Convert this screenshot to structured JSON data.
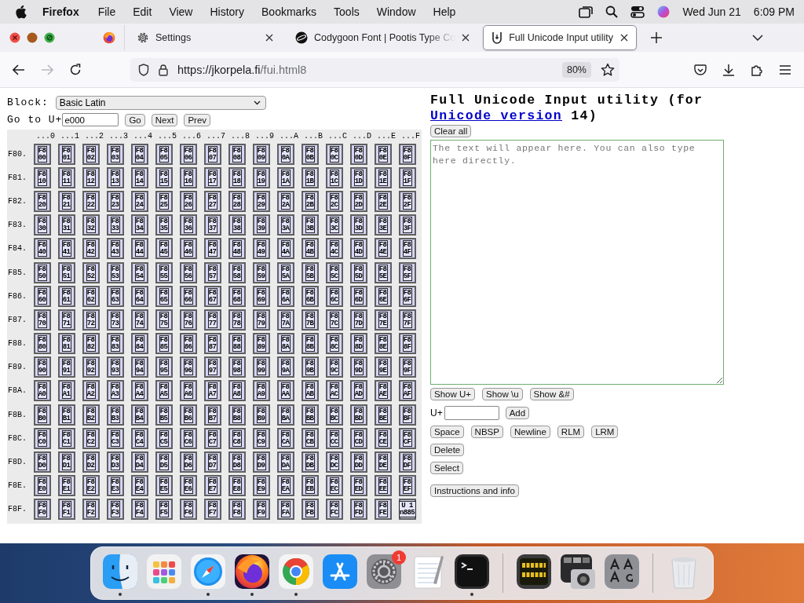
{
  "menubar": {
    "app": "Firefox",
    "menus": [
      "File",
      "Edit",
      "View",
      "History",
      "Bookmarks",
      "Tools",
      "Window",
      "Help"
    ],
    "date": "Wed Jun 21",
    "time": "6:09 PM"
  },
  "tabs": [
    {
      "kind": "pinned",
      "selected": false
    },
    {
      "kind": "settings",
      "label": "Settings",
      "selected": false
    },
    {
      "kind": "site",
      "label": "Codygoon Font | Pootis Type Co",
      "selected": false
    },
    {
      "kind": "unicode",
      "label": "Full Unicode Input utility",
      "selected": true
    }
  ],
  "address": {
    "host": "https://jkorpela.fi",
    "path": "/fui.html8",
    "zoom": "80%"
  },
  "left": {
    "block_label": "Block:",
    "block_value": "Basic Latin",
    "goto_label": "Go to U+",
    "goto_value": "e000",
    "buttons": [
      "Go",
      "Next",
      "Prev"
    ],
    "columns": [
      "...0",
      "...1",
      "...2",
      "...3",
      "...4",
      "...5",
      "...6",
      "...7",
      "...8",
      "...9",
      "...A",
      "...B",
      "...C",
      "...D",
      "...E",
      "...F"
    ],
    "rows": [
      {
        "label": "F80.",
        "cells": [
          "F8\n00",
          "F8\n01",
          "F8\n02",
          "F8\n03",
          "F8\n04",
          "F8\n05",
          "F8\n06",
          "F8\n07",
          "F8\n08",
          "F8\n09",
          "F8\n0A",
          "F8\n0B",
          "F8\n0C",
          "F8\n0D",
          "F8\n0E",
          "F8\n0F"
        ]
      },
      {
        "label": "F81.",
        "cells": [
          "F8\n10",
          "F8\n11",
          "F8\n12",
          "F8\n13",
          "F8\n14",
          "F8\n15",
          "F8\n16",
          "F8\n17",
          "F8\n18",
          "F8\n19",
          "F8\n1A",
          "F8\n1B",
          "F8\n1C",
          "F8\n1D",
          "F8\n1E",
          "F8\n1F"
        ]
      },
      {
        "label": "F82.",
        "cells": [
          "F8\n20",
          "F8\n21",
          "F8\n22",
          "F8\n23",
          "F8\n24",
          "F8\n25",
          "F8\n26",
          "F8\n27",
          "F8\n28",
          "F8\n29",
          "F8\n2A",
          "F8\n2B",
          "F8\n2C",
          "F8\n2D",
          "F8\n2E",
          "F8\n2F"
        ]
      },
      {
        "label": "F83.",
        "cells": [
          "F8\n30",
          "F8\n31",
          "F8\n32",
          "F8\n33",
          "F8\n34",
          "F8\n35",
          "F8\n36",
          "F8\n37",
          "F8\n38",
          "F8\n39",
          "F8\n3A",
          "F8\n3B",
          "F8\n3C",
          "F8\n3D",
          "F8\n3E",
          "F8\n3F"
        ]
      },
      {
        "label": "F84.",
        "cells": [
          "F8\n40",
          "F8\n41",
          "F8\n42",
          "F8\n43",
          "F8\n44",
          "F8\n45",
          "F8\n46",
          "F8\n47",
          "F8\n48",
          "F8\n49",
          "F8\n4A",
          "F8\n4B",
          "F8\n4C",
          "F8\n4D",
          "F8\n4E",
          "F8\n4F"
        ]
      },
      {
        "label": "F85.",
        "cells": [
          "F8\n50",
          "F8\n51",
          "F8\n52",
          "F8\n53",
          "F8\n54",
          "F8\n55",
          "F8\n56",
          "F8\n57",
          "F8\n58",
          "F8\n59",
          "F8\n5A",
          "F8\n5B",
          "F8\n5C",
          "F8\n5D",
          "F8\n5E",
          "F8\n5F"
        ]
      },
      {
        "label": "F86.",
        "cells": [
          "F8\n60",
          "F8\n61",
          "F8\n62",
          "F8\n63",
          "F8\n64",
          "F8\n65",
          "F8\n66",
          "F8\n67",
          "F8\n68",
          "F8\n69",
          "F8\n6A",
          "F8\n6B",
          "F8\n6C",
          "F8\n6D",
          "F8\n6E",
          "F8\n6F"
        ]
      },
      {
        "label": "F87.",
        "cells": [
          "F8\n70",
          "F8\n71",
          "F8\n72",
          "F8\n73",
          "F8\n74",
          "F8\n75",
          "F8\n76",
          "F8\n77",
          "F8\n78",
          "F8\n79",
          "F8\n7A",
          "F8\n7B",
          "F8\n7C",
          "F8\n7D",
          "F8\n7E",
          "F8\n7F"
        ]
      },
      {
        "label": "F88.",
        "cells": [
          "F8\n80",
          "F8\n81",
          "F8\n82",
          "F8\n83",
          "F8\n84",
          "F8\n85",
          "F8\n86",
          "F8\n87",
          "F8\n88",
          "F8\n89",
          "F8\n8A",
          "F8\n8B",
          "F8\n8C",
          "F8\n8D",
          "F8\n8E",
          "F8\n8F"
        ]
      },
      {
        "label": "F89.",
        "cells": [
          "F8\n90",
          "F8\n91",
          "F8\n92",
          "F8\n93",
          "F8\n94",
          "F8\n95",
          "F8\n96",
          "F8\n97",
          "F8\n98",
          "F8\n99",
          "F8\n9A",
          "F8\n9B",
          "F8\n9C",
          "F8\n9D",
          "F8\n9E",
          "F8\n9F"
        ]
      },
      {
        "label": "F8A.",
        "cells": [
          "F8\nA0",
          "F8\nA1",
          "F8\nA2",
          "F8\nA3",
          "F8\nA4",
          "F8\nA5",
          "F8\nA6",
          "F8\nA7",
          "F8\nA8",
          "F8\nA9",
          "F8\nAA",
          "F8\nAB",
          "F8\nAC",
          "F8\nAD",
          "F8\nAE",
          "F8\nAF"
        ]
      },
      {
        "label": "F8B.",
        "cells": [
          "F8\nB0",
          "F8\nB1",
          "F8\nB2",
          "F8\nB3",
          "F8\nB4",
          "F8\nB5",
          "F8\nB6",
          "F8\nB7",
          "F8\nB8",
          "F8\nB9",
          "F8\nBA",
          "F8\nBB",
          "F8\nBC",
          "F8\nBD",
          "F8\nBE",
          "F8\nBF"
        ]
      },
      {
        "label": "F8C.",
        "cells": [
          "F8\nC0",
          "F8\nC1",
          "F8\nC2",
          "F8\nC3",
          "F8\nC4",
          "F8\nC5",
          "F8\nC6",
          "F8\nC7",
          "F8\nC8",
          "F8\nC9",
          "F8\nCA",
          "F8\nCB",
          "F8\nCC",
          "F8\nCD",
          "F8\nCE",
          "F8\nCF"
        ]
      },
      {
        "label": "F8D.",
        "cells": [
          "F8\nD0",
          "F8\nD1",
          "F8\nD2",
          "F8\nD3",
          "F8\nD4",
          "F8\nD5",
          "F8\nD6",
          "F8\nD7",
          "F8\nD8",
          "F8\nD9",
          "F8\nDA",
          "F8\nDB",
          "F8\nDC",
          "F8\nDD",
          "F8\nDE",
          "F8\nDF"
        ]
      },
      {
        "label": "F8E.",
        "cells": [
          "F8\nE0",
          "F8\nE1",
          "F8\nE2",
          "F8\nE3",
          "F8\nE4",
          "F8\nE5",
          "F8\nE6",
          "F8\nE7",
          "F8\nE8",
          "F8\nE9",
          "F8\nEA",
          "F8\nEB",
          "F8\nEC",
          "F8\nED",
          "F8\nEE",
          "F8\nEF"
        ]
      },
      {
        "label": "F8F.",
        "cells": [
          "F8\nF0",
          "F8\nF1",
          "F8\nF2",
          "F8\nF3",
          "F8\nF4",
          "F8\nF5",
          "F8\nF6",
          "F8\nF7",
          "F8\nF8",
          "F8\nF9",
          "F8\nFA",
          "F8\nFB",
          "F8\nFC",
          "F8\nFD",
          "F8\nFE",
          "U 1\nn885"
        ]
      }
    ]
  },
  "right": {
    "title_before": "Full Unicode Input utility (for ",
    "title_link": "Unicode version",
    "title_after": " 14)",
    "clear_button": "Clear all",
    "placeholder": "The text will appear here. You can also type here directly.",
    "show_buttons": [
      "Show U+",
      "Show \\u",
      "Show &#"
    ],
    "add_label": "U+",
    "add_button": "Add",
    "insert_buttons": [
      "Space",
      "NBSP",
      "Newline",
      "RLM",
      "LRM"
    ],
    "delete_button": "Delete",
    "select_button": "Select",
    "info_button": "Instructions and info"
  },
  "dock": [
    {
      "kind": "finder",
      "running": true
    },
    {
      "kind": "launchpad",
      "running": false
    },
    {
      "kind": "safari",
      "running": true
    },
    {
      "kind": "firefox",
      "running": true
    },
    {
      "kind": "chrome",
      "running": true
    },
    {
      "kind": "appstore",
      "running": false
    },
    {
      "kind": "settings",
      "running": false,
      "badge": "1"
    },
    {
      "kind": "textedit",
      "running": false
    },
    {
      "kind": "terminal",
      "running": true
    },
    {
      "kind": "separator"
    },
    {
      "kind": "console",
      "running": false
    },
    {
      "kind": "screenshot",
      "running": false
    },
    {
      "kind": "fontbook",
      "running": false
    },
    {
      "kind": "separator"
    },
    {
      "kind": "trash",
      "running": false
    }
  ]
}
